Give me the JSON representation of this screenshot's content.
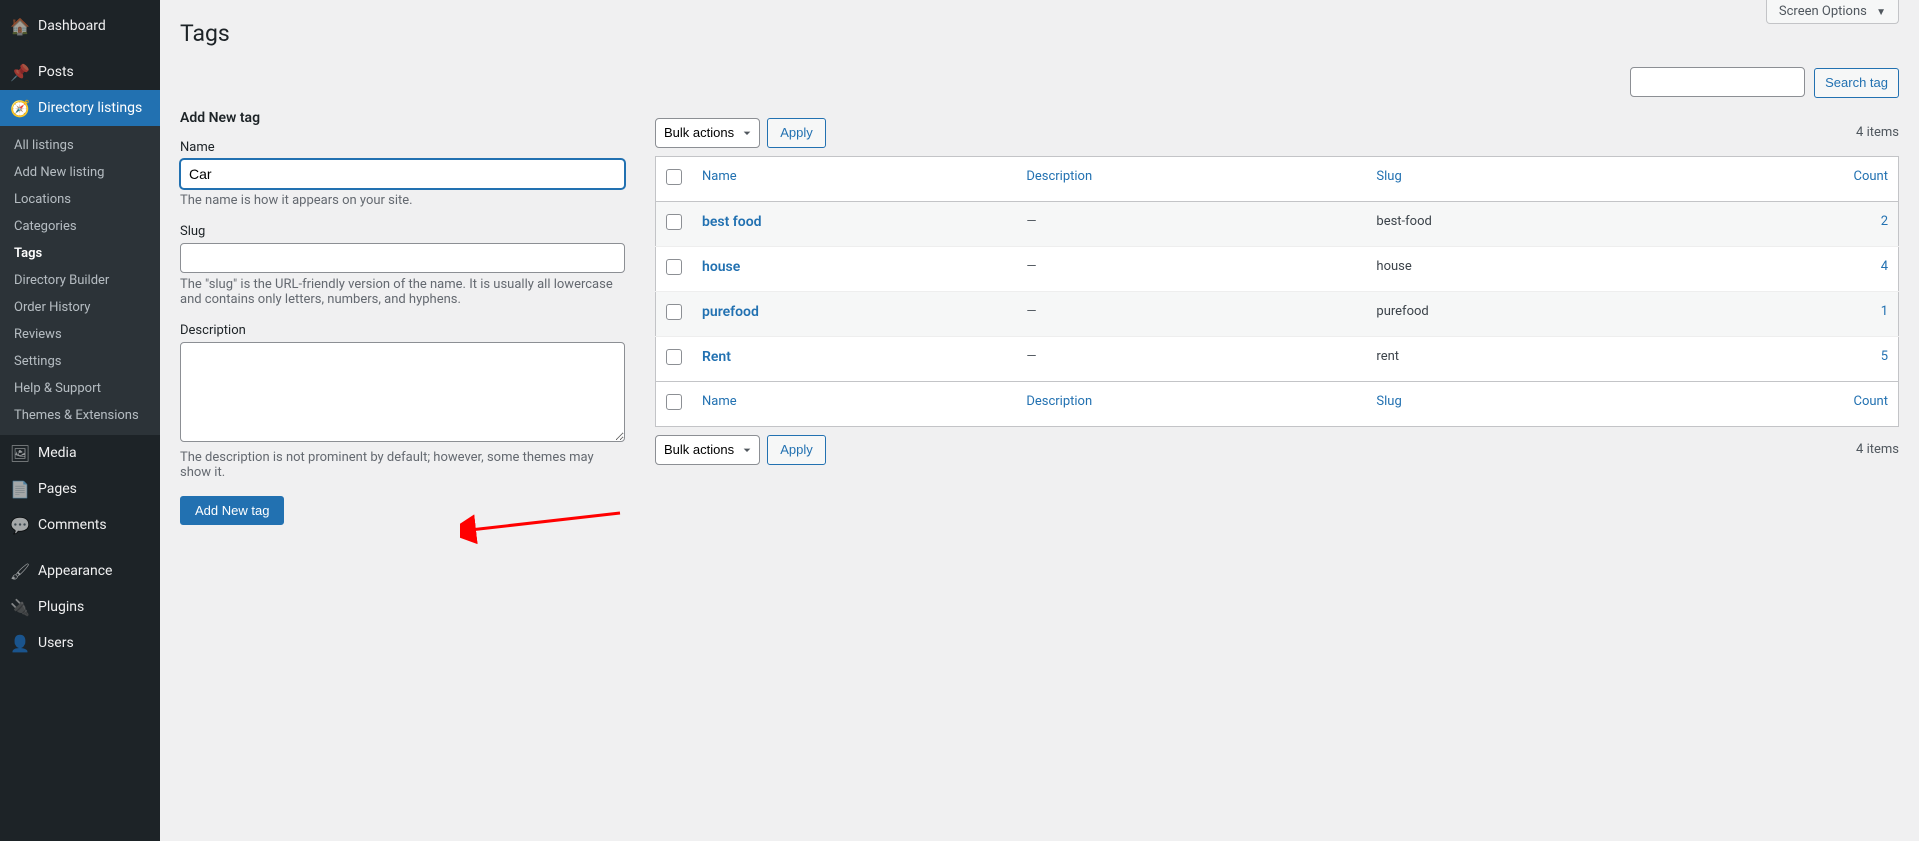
{
  "screen_options_label": "Screen Options",
  "page_title": "Tags",
  "sidebar": {
    "items": [
      {
        "label": "Dashboard",
        "icon": "🏠"
      },
      {
        "label": "Posts",
        "icon": "📌"
      },
      {
        "label": "Directory listings",
        "icon": "🧭",
        "current": true
      },
      {
        "label": "Media",
        "icon": "🖼"
      },
      {
        "label": "Pages",
        "icon": "📄"
      },
      {
        "label": "Comments",
        "icon": "💬"
      },
      {
        "label": "Appearance",
        "icon": "🖌"
      },
      {
        "label": "Plugins",
        "icon": "🔌"
      },
      {
        "label": "Users",
        "icon": "👤"
      }
    ],
    "submenu": [
      {
        "label": "All listings"
      },
      {
        "label": "Add New listing"
      },
      {
        "label": "Locations"
      },
      {
        "label": "Categories"
      },
      {
        "label": "Tags",
        "current": true
      },
      {
        "label": "Directory Builder"
      },
      {
        "label": "Order History"
      },
      {
        "label": "Reviews"
      },
      {
        "label": "Settings"
      },
      {
        "label": "Help & Support"
      },
      {
        "label": "Themes & Extensions"
      }
    ]
  },
  "search": {
    "button": "Search tag"
  },
  "form": {
    "heading": "Add New tag",
    "name_label": "Name",
    "name_value": "Car",
    "name_help": "The name is how it appears on your site.",
    "slug_label": "Slug",
    "slug_value": "",
    "slug_help": "The \"slug\" is the URL-friendly version of the name. It is usually all lowercase and contains only letters, numbers, and hyphens.",
    "desc_label": "Description",
    "desc_value": "",
    "desc_help": "The description is not prominent by default; however, some themes may show it.",
    "submit": "Add New tag"
  },
  "bulk": {
    "label": "Bulk actions",
    "apply": "Apply"
  },
  "items_count": "4 items",
  "table": {
    "headers": {
      "name": "Name",
      "description": "Description",
      "slug": "Slug",
      "count": "Count"
    },
    "rows": [
      {
        "name": "best food",
        "description": "—",
        "slug": "best-food",
        "count": "2"
      },
      {
        "name": "house",
        "description": "—",
        "slug": "house",
        "count": "4"
      },
      {
        "name": "purefood",
        "description": "—",
        "slug": "purefood",
        "count": "1"
      },
      {
        "name": "Rent",
        "description": "—",
        "slug": "rent",
        "count": "5"
      }
    ]
  }
}
